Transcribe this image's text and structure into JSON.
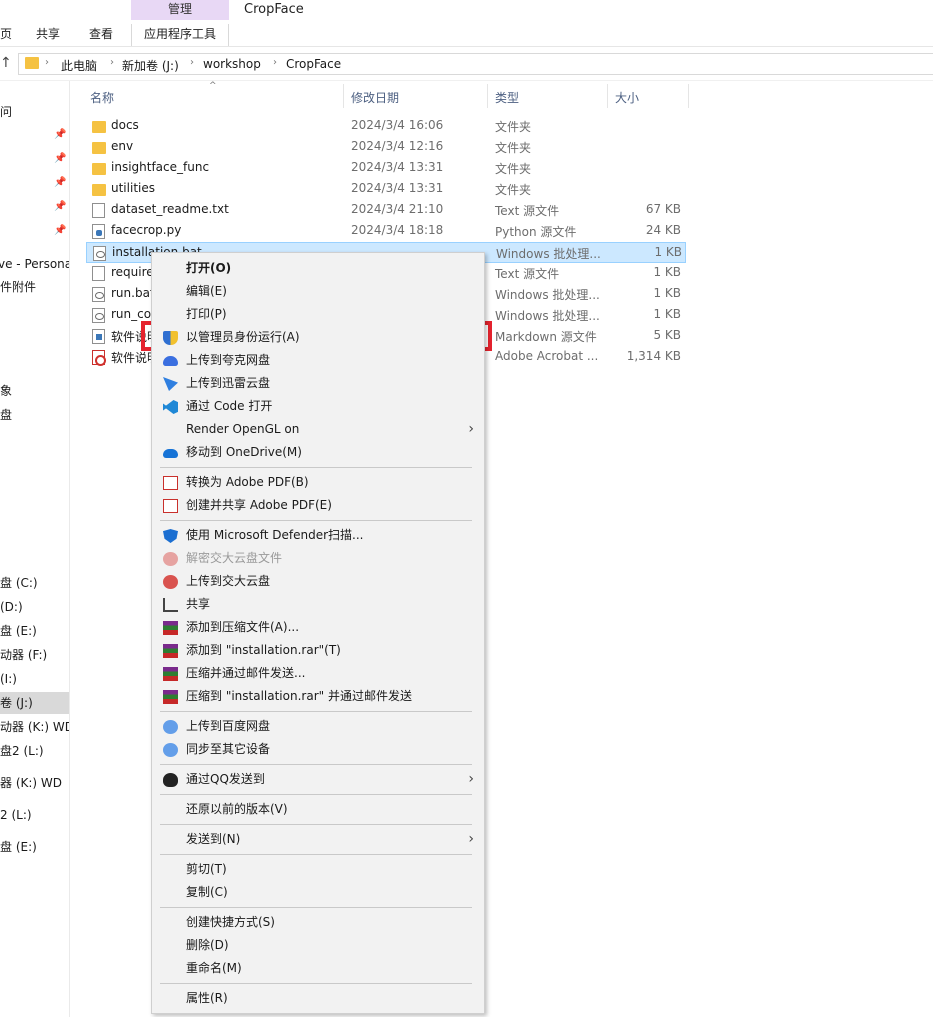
{
  "ribbon": {
    "partial_tab": "页",
    "tab_share": "共享",
    "tab_view": "查看",
    "manage_label": "管理",
    "tab_app_tools": "应用程序工具",
    "window_title": "CropFace"
  },
  "address": {
    "crumbs": [
      "此电脑",
      "新加卷 (J:)",
      "workshop",
      "CropFace"
    ]
  },
  "nav": {
    "items": [
      {
        "label": "问",
        "pinned": false
      },
      {
        "label": "",
        "pinned": true
      },
      {
        "label": "",
        "pinned": true
      },
      {
        "label": "",
        "pinned": true
      },
      {
        "label": "",
        "pinned": true
      },
      {
        "label": "",
        "pinned": true
      },
      {
        "label": "ve - Persona",
        "pinned": false
      },
      {
        "label": "件附件",
        "pinned": false
      },
      {
        "label": "象",
        "pinned": false
      },
      {
        "label": "盘",
        "pinned": false
      },
      {
        "label": "盘 (C:)",
        "pinned": false
      },
      {
        "label": "(D:)",
        "pinned": false
      },
      {
        "label": "盘 (E:)",
        "pinned": false
      },
      {
        "label": "动器 (F:)",
        "pinned": false
      },
      {
        "label": "(I:)",
        "pinned": false
      },
      {
        "label": "卷 (J:)",
        "pinned": false,
        "selected": true
      },
      {
        "label": "动器 (K:) WD",
        "pinned": false
      },
      {
        "label": "盘2 (L:)",
        "pinned": false
      },
      {
        "label": "器 (K:) WD",
        "pinned": false
      },
      {
        "label": "2 (L:)",
        "pinned": false
      },
      {
        "label": "盘 (E:)",
        "pinned": false
      }
    ]
  },
  "columns": {
    "name": "名称",
    "modified": "修改日期",
    "type": "类型",
    "size": "大小"
  },
  "files": [
    {
      "name": "docs",
      "date": "2024/3/4 16:06",
      "type": "文件夹",
      "size": "",
      "icon": "folder-icon"
    },
    {
      "name": "env",
      "date": "2024/3/4 12:16",
      "type": "文件夹",
      "size": "",
      "icon": "folder-icon"
    },
    {
      "name": "insightface_func",
      "date": "2024/3/4 13:31",
      "type": "文件夹",
      "size": "",
      "icon": "folder-icon"
    },
    {
      "name": "utilities",
      "date": "2024/3/4 13:31",
      "type": "文件夹",
      "size": "",
      "icon": "folder-icon"
    },
    {
      "name": "dataset_readme.txt",
      "date": "2024/3/4 21:10",
      "type": "Text 源文件",
      "size": "67 KB",
      "icon": "text-file-icon"
    },
    {
      "name": "facecrop.py",
      "date": "2024/3/4 18:18",
      "type": "Python 源文件",
      "size": "24 KB",
      "icon": "python-file-icon"
    },
    {
      "name": "installation.bat",
      "date": "",
      "type": "Windows 批处理...",
      "size": "1 KB",
      "icon": "batch-file-icon",
      "selected": true
    },
    {
      "name": "require",
      "date": "",
      "type": "Text 源文件",
      "size": "1 KB",
      "icon": "text-file-icon"
    },
    {
      "name": "run.bat",
      "date": "",
      "type": "Windows 批处理...",
      "size": "1 KB",
      "icon": "batch-file-icon"
    },
    {
      "name": "run_co",
      "date": "",
      "type": "Windows 批处理...",
      "size": "1 KB",
      "icon": "batch-file-icon"
    },
    {
      "name": "软件说明",
      "date": "",
      "type": "Markdown 源文件",
      "size": "5 KB",
      "icon": "markdown-file-icon"
    },
    {
      "name": "软件说明",
      "date": "",
      "type": "Adobe Acrobat ...",
      "size": "1,314 KB",
      "icon": "pdf-file-icon"
    }
  ],
  "context_menu": {
    "items": [
      {
        "label": "打开(O)",
        "icon": "",
        "bold": true
      },
      {
        "label": "编辑(E)",
        "icon": ""
      },
      {
        "label": "打印(P)",
        "icon": ""
      },
      {
        "label": "以管理员身份运行(A)",
        "icon": "uac-shield-icon",
        "highlighted": true
      },
      {
        "label": "上传到夸克网盘",
        "icon": "quark-cloud-icon"
      },
      {
        "label": "上传到迅雷云盘",
        "icon": "xunlei-icon"
      },
      {
        "label": "通过 Code 打开",
        "icon": "vscode-icon"
      },
      {
        "label": "Render OpenGL on",
        "icon": "",
        "submenu": true
      },
      {
        "label": "移动到 OneDrive(M)",
        "icon": "onedrive-icon"
      },
      {
        "separator": true
      },
      {
        "label": "转换为 Adobe PDF(B)",
        "icon": "adobe-pdf-icon"
      },
      {
        "label": "创建并共享 Adobe PDF(E)",
        "icon": "adobe-pdf-share-icon"
      },
      {
        "separator": true
      },
      {
        "label": "使用 Microsoft Defender扫描...",
        "icon": "defender-icon"
      },
      {
        "label": "解密交大云盘文件",
        "icon": "jiaoda-cloud-icon",
        "disabled": true
      },
      {
        "label": "上传到交大云盘",
        "icon": "jiaoda-cloud-icon"
      },
      {
        "label": "共享",
        "icon": "share-icon"
      },
      {
        "label": "添加到压缩文件(A)...",
        "icon": "winrar-icon"
      },
      {
        "label": "添加到 \"installation.rar\"(T)",
        "icon": "winrar-icon"
      },
      {
        "label": "压缩并通过邮件发送...",
        "icon": "winrar-icon"
      },
      {
        "label": "压缩到 \"installation.rar\" 并通过邮件发送",
        "icon": "winrar-icon"
      },
      {
        "separator": true
      },
      {
        "label": "上传到百度网盘",
        "icon": "baidu-netdisk-icon"
      },
      {
        "label": "同步至其它设备",
        "icon": "baidu-netdisk-icon"
      },
      {
        "separator": true
      },
      {
        "label": "通过QQ发送到",
        "icon": "qq-icon",
        "submenu": true
      },
      {
        "separator": true
      },
      {
        "label": "还原以前的版本(V)",
        "icon": ""
      },
      {
        "separator": true
      },
      {
        "label": "发送到(N)",
        "icon": "",
        "submenu": true
      },
      {
        "separator": true
      },
      {
        "label": "剪切(T)",
        "icon": ""
      },
      {
        "label": "复制(C)",
        "icon": ""
      },
      {
        "separator": true
      },
      {
        "label": "创建快捷方式(S)",
        "icon": ""
      },
      {
        "label": "删除(D)",
        "icon": ""
      },
      {
        "label": "重命名(M)",
        "icon": ""
      },
      {
        "separator": true
      },
      {
        "label": "属性(R)",
        "icon": ""
      }
    ]
  },
  "colors": {
    "highlight_border": "#e5232e",
    "selection_bg": "#cce8ff",
    "manage_tab_bg": "#e8d8f5",
    "folder": "#f5c242"
  }
}
